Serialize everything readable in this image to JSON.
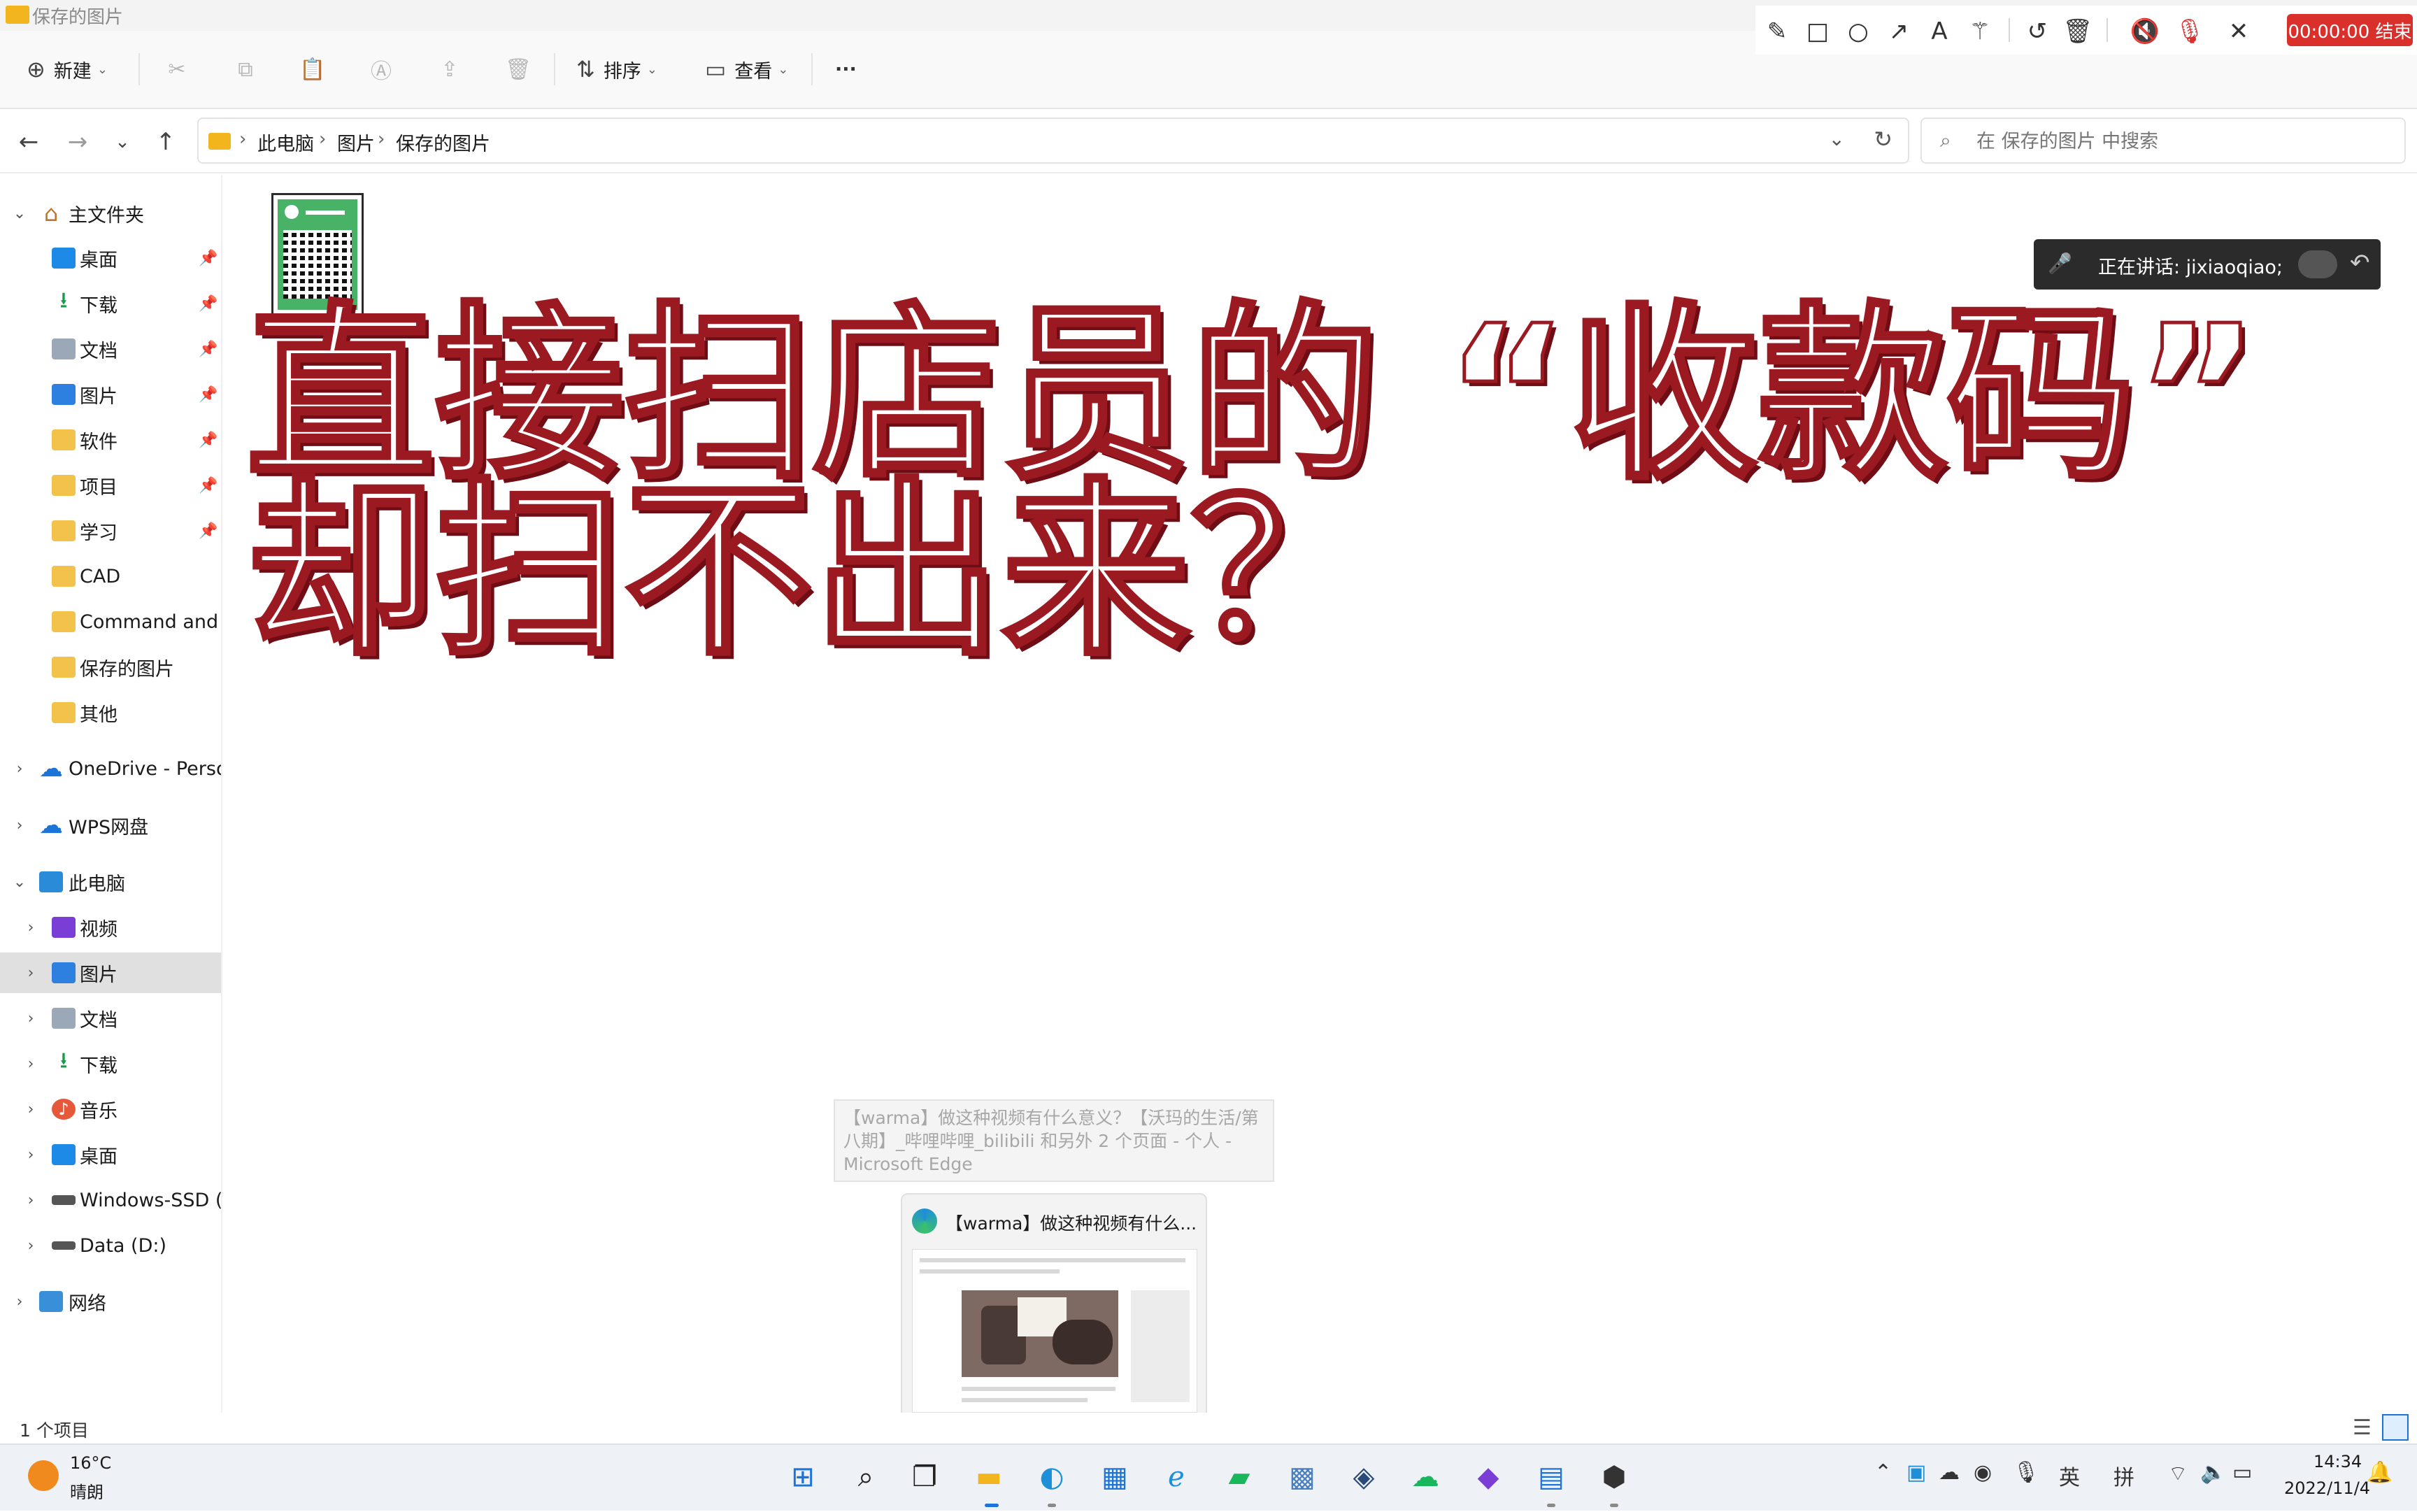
{
  "window": {
    "title": "保存的图片"
  },
  "recorder": {
    "timer": "00:00:00 结束"
  },
  "commandbar": {
    "new_label": "新建",
    "sort_label": "排序",
    "view_label": "查看",
    "more_label": "···"
  },
  "address": {
    "crumbs": [
      "此电脑",
      "图片",
      "保存的图片"
    ]
  },
  "search": {
    "placeholder": "在 保存的图片 中搜索"
  },
  "sidebar": {
    "home": "主文件夹",
    "quick": [
      "桌面",
      "下载",
      "文档",
      "图片",
      "软件",
      "项目",
      "学习",
      "CAD",
      "Command and Co",
      "保存的图片",
      "其他"
    ],
    "onedrive": "OneDrive - Persona",
    "wps": "WPS网盘",
    "thispc": "此电脑",
    "pc_items": [
      "视频",
      "图片",
      "文档",
      "下载",
      "音乐",
      "桌面",
      "Windows-SSD (C:",
      "Data (D:)"
    ],
    "network": "网络"
  },
  "overlay": {
    "line1": "直接扫店员的 “收款码”",
    "line2": "却扫不出来？"
  },
  "speaking": {
    "text": "正在讲话: jixiaoqiao;"
  },
  "taskbar_preview": {
    "tooltip": "【warma】做这种视频有什么意义？【沃玛的生活/第八期】_哔哩哔哩_bilibili 和另外 2 个页面 - 个人 - Microsoft Edge",
    "title": "【warma】做这种视频有什么..."
  },
  "status": {
    "items_count": "1 个项目"
  },
  "weather": {
    "temp": "16°C",
    "cond": "晴朗"
  },
  "tray": {
    "lang": "英",
    "ime": "拼"
  },
  "clock": {
    "time": "14:34",
    "date": "2022/11/4"
  },
  "colors": {
    "accent": "#1c74d8",
    "record_red": "#d9302c",
    "overlay_stroke": "#9b1a22"
  }
}
